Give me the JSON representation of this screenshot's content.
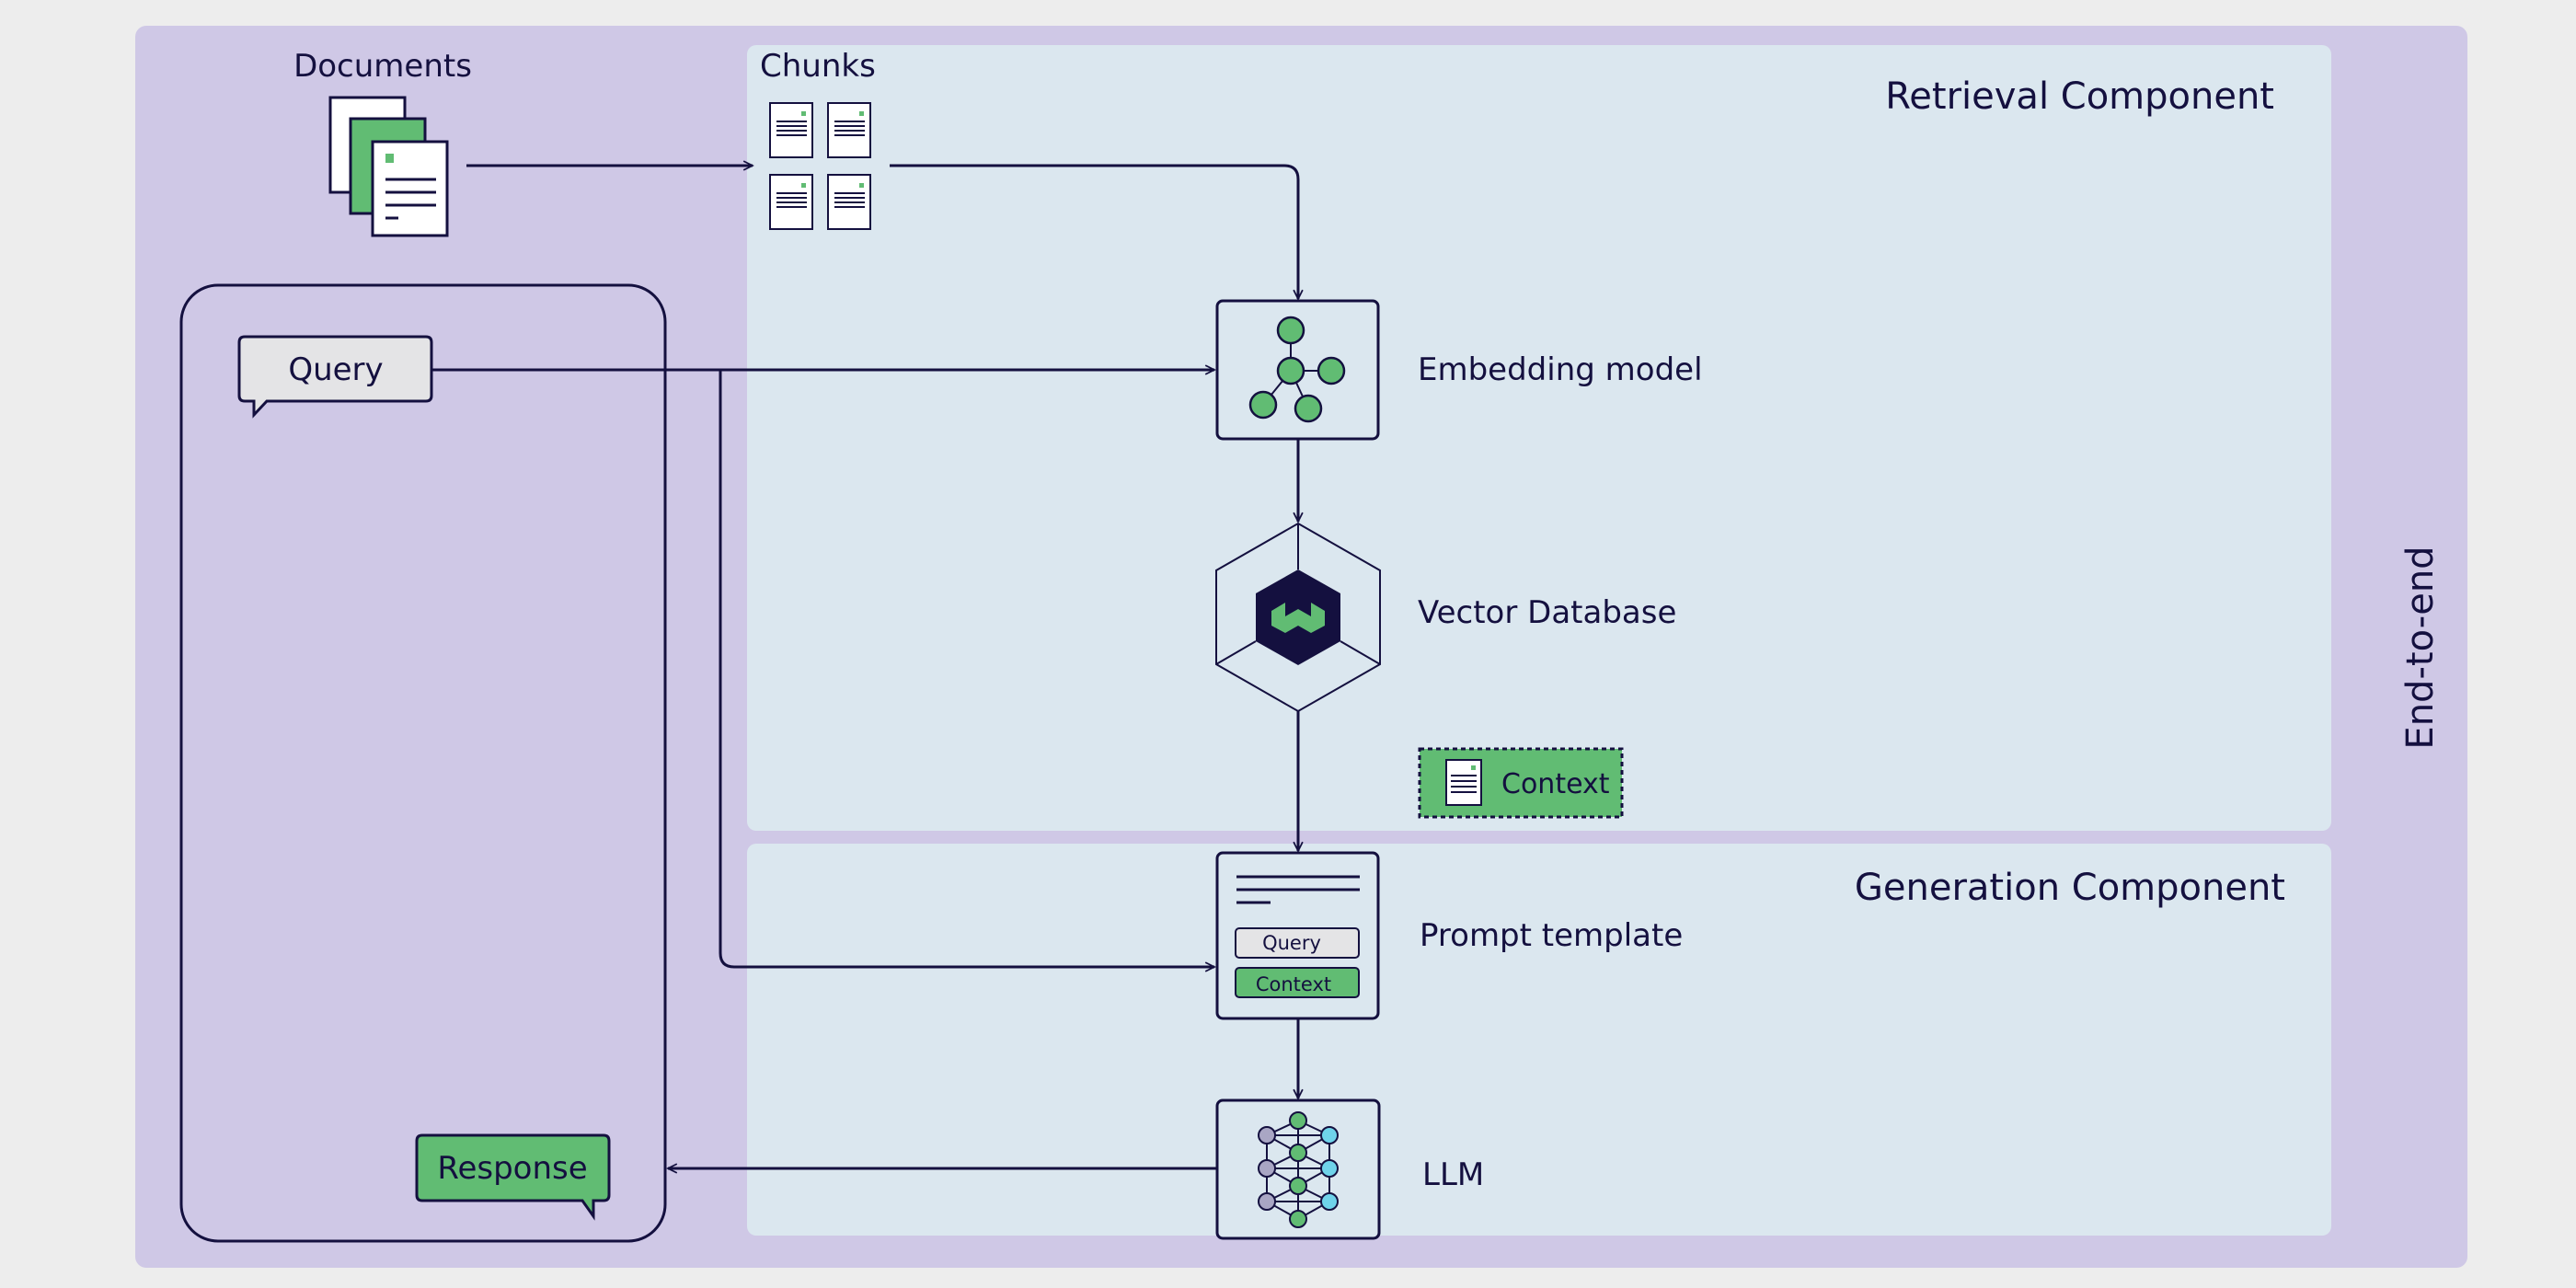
{
  "colors": {
    "background": "#ededed",
    "outer_panel": "#cfc8e6",
    "inner_panel": "#dbe7ef",
    "ink": "#14103f",
    "green": "#61bc73",
    "grey_bubble": "#e4e4e6",
    "cyan": "#6fd3ea",
    "grey_node": "#a9a6c4"
  },
  "outer": {
    "label": "End-to-end"
  },
  "retrieval": {
    "title": "Retrieval Component",
    "chunks_label": "Chunks",
    "embedding_label": "Embedding model",
    "vector_db_label": "Vector Database",
    "context_label": "Context"
  },
  "generation": {
    "title": "Generation Component",
    "prompt_label": "Prompt template",
    "prompt_query_pill": "Query",
    "prompt_context_pill": "Context",
    "llm_label": "LLM"
  },
  "user": {
    "documents_label": "Documents",
    "query_bubble": "Query",
    "response_bubble": "Response"
  },
  "icons": {
    "documents": "document-stack-icon",
    "chunks": "document-chunk-icon",
    "embedding": "network-graph-icon",
    "vector_db": "hexagon-database-icon",
    "context": "document-icon",
    "prompt": "template-icon",
    "llm": "neural-network-icon"
  }
}
